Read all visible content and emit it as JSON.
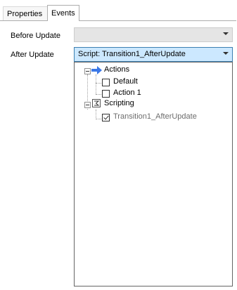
{
  "tabs": [
    {
      "label": "Properties"
    },
    {
      "label": "Events"
    }
  ],
  "fields": {
    "before_update": {
      "label": "Before Update",
      "value": ""
    },
    "after_update": {
      "label": "After Update",
      "value": "Script: Transition1_AfterUpdate"
    }
  },
  "tree": {
    "actions": {
      "label": "Actions",
      "icon": "arrow-right-icon",
      "children": [
        {
          "label": "Default",
          "checked": false
        },
        {
          "label": "Action 1",
          "checked": false
        }
      ]
    },
    "scripting": {
      "label": "Scripting",
      "icon": "script-icon",
      "children": [
        {
          "label": "Transition1_AfterUpdate",
          "checked": true
        }
      ]
    }
  },
  "colors": {
    "accent_selection": "#cce8ff",
    "accent_border": "#3c7fb1",
    "arrow_blue": "#3b78e7"
  }
}
